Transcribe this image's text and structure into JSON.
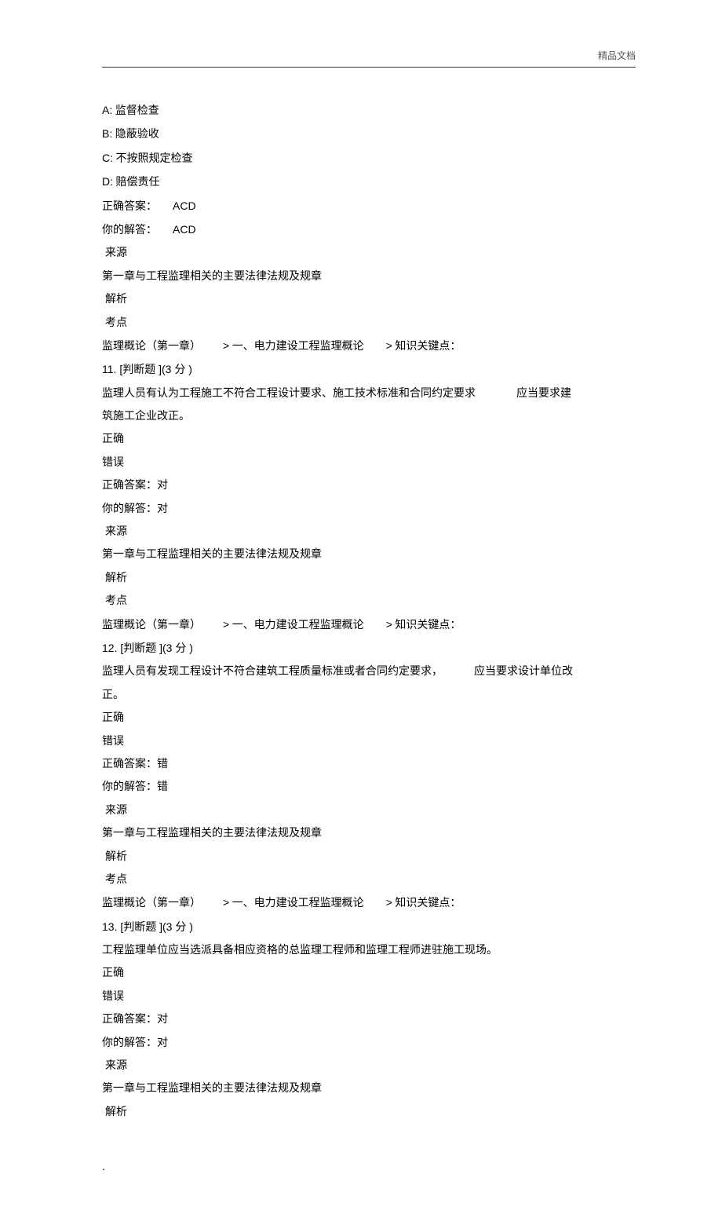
{
  "header": {
    "label": "精品文档"
  },
  "options": {
    "A": {
      "letter": "A:",
      "text": "监督检查"
    },
    "B": {
      "letter": "B:",
      "text": "隐蔽验收"
    },
    "C": {
      "letter": "C:",
      "text": "不按照规定检查"
    },
    "D": {
      "letter": "D:",
      "text": "赔偿责任"
    }
  },
  "answer10": {
    "correctLabel": "正确答案：",
    "correctValue": "ACD",
    "yourLabel": "你的解答：",
    "yourValue": "ACD"
  },
  "meta": {
    "sourceLabel": "来源",
    "sourceText": "第一章与工程监理相关的主要法律法规及规章",
    "analysisLabel": "解析",
    "pointLabel": "考点",
    "pointPart1": "监理概论（第一章）",
    "pointGt1": ">",
    "pointPart2": "一、电力建设工程监理概论",
    "pointGt2": ">",
    "pointPart3": "知识关键点："
  },
  "q11": {
    "header": "11. [判断题 ](3 分 )",
    "line1a": "监理人员有认为工程施工不符合工程设计要求、施工技术标准和合同约定要求",
    "line1b": "应当要求建",
    "line2": "筑施工企业改正。",
    "optTrue": "正确",
    "optFalse": "错误",
    "correct": "正确答案：对",
    "your": "你的解答：对"
  },
  "q12": {
    "header": "12. [判断题 ](3 分 )",
    "line1a": "监理人员有发现工程设计不符合建筑工程质量标准或者合同约定要求，",
    "line1b": "应当要求设计单位改",
    "line2": "正。",
    "optTrue": "正确",
    "optFalse": "错误",
    "correct": "正确答案：错",
    "your": "你的解答：错"
  },
  "q13": {
    "header": "13. [判断题 ](3 分 )",
    "line1": "工程监理单位应当选派具备相应资格的总监理工程师和监理工程师进驻施工现场。",
    "optTrue": "正确",
    "optFalse": "错误",
    "correct": "正确答案：对",
    "your": "你的解答：对"
  },
  "footer": {
    "dot": "."
  }
}
